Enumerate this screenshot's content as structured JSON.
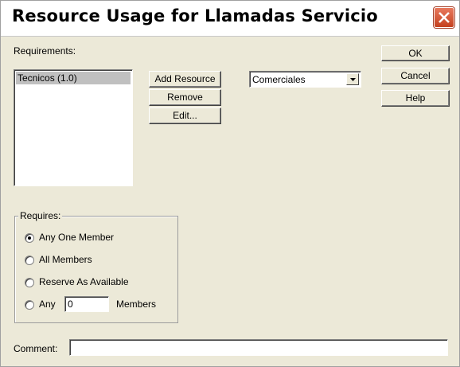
{
  "window": {
    "title": "Resource Usage for Llamadas Servicio"
  },
  "requirements": {
    "label": "Requirements:",
    "items": [
      "Tecnicos (1.0)"
    ],
    "selected_item": "Tecnicos (1.0)"
  },
  "buttons": {
    "add_resource": "Add Resource",
    "remove": "Remove",
    "edit": "Edit...",
    "ok": "OK",
    "cancel": "Cancel",
    "help": "Help"
  },
  "resource_combo": {
    "value": "Comerciales"
  },
  "requires": {
    "label": "Requires:",
    "options": {
      "any_one": "Any One Member",
      "all": "All Members",
      "reserve": "Reserve As Available",
      "any": "Any"
    },
    "selected": "Any One Member",
    "any_count": "0",
    "members_suffix": "Members"
  },
  "comment": {
    "label": "Comment:",
    "value": ""
  }
}
